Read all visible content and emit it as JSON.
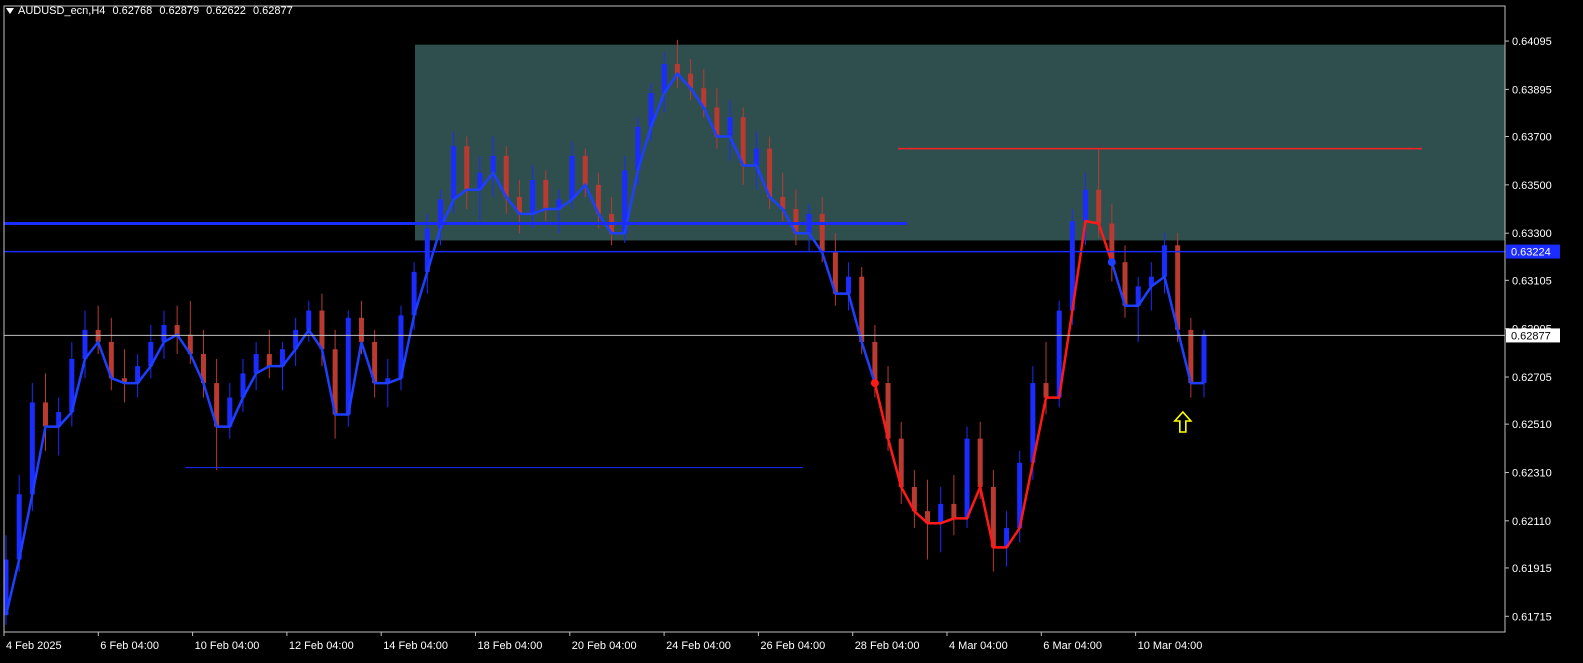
{
  "header": {
    "symbol": "AUDUSD_ecn,H4",
    "open": "0.62768",
    "high": "0.62879",
    "low": "0.62622",
    "close": "0.62877"
  },
  "colors": {
    "background": "#000000",
    "grid_text": "#ffffff",
    "bull_candle": "#1a2cff",
    "bear_candle": "#b83a30",
    "trend_line_up": "#1f3fff",
    "trend_line_down": "#ff1a1a",
    "zone_fill": "#2f4f4f",
    "level_line": "#1a2cff",
    "resistance_line": "#ff2020",
    "arrow": "#ffff00",
    "price_label_bg": "#1a2cff"
  },
  "chart_data": {
    "type": "candlestick",
    "title": "AUDUSD_ecn,H4",
    "y_ticks": [
      "0.64095",
      "0.63895",
      "0.63700",
      "0.63500",
      "0.63300",
      "0.63105",
      "0.62905",
      "0.62705",
      "0.62510",
      "0.62310",
      "0.62110",
      "0.61915",
      "0.61715"
    ],
    "x_ticks": [
      "4 Feb 2025",
      "6 Feb 04:00",
      "10 Feb 04:00",
      "12 Feb 04:00",
      "14 Feb 04:00",
      "18 Feb 04:00",
      "20 Feb 04:00",
      "24 Feb 04:00",
      "26 Feb 04:00",
      "28 Feb 04:00",
      "4 Mar 04:00",
      "6 Mar 04:00",
      "10 Mar 04:00"
    ],
    "ylim": [
      0.6165,
      0.6424
    ],
    "current_price": "0.62877",
    "level_price": "0.63224",
    "zone": {
      "top": 0.6408,
      "bottom": 0.6327
    },
    "resistance": 0.6365,
    "support_line": 0.6233,
    "blue_level": 0.6334,
    "candles": [
      [
        0.6172,
        0.6205,
        0.6168,
        0.6195
      ],
      [
        0.6195,
        0.623,
        0.619,
        0.6222
      ],
      [
        0.6222,
        0.6268,
        0.6215,
        0.626
      ],
      [
        0.626,
        0.6272,
        0.624,
        0.625
      ],
      [
        0.625,
        0.6262,
        0.6238,
        0.6256
      ],
      [
        0.6256,
        0.6285,
        0.625,
        0.6278
      ],
      [
        0.6278,
        0.6298,
        0.627,
        0.629
      ],
      [
        0.629,
        0.63,
        0.628,
        0.6285
      ],
      [
        0.6285,
        0.6295,
        0.6265,
        0.627
      ],
      [
        0.627,
        0.6282,
        0.626,
        0.6268
      ],
      [
        0.6268,
        0.628,
        0.6262,
        0.6275
      ],
      [
        0.6275,
        0.6292,
        0.627,
        0.6285
      ],
      [
        0.6285,
        0.6298,
        0.6278,
        0.6292
      ],
      [
        0.6292,
        0.63,
        0.628,
        0.6288
      ],
      [
        0.6288,
        0.6302,
        0.6276,
        0.628
      ],
      [
        0.628,
        0.629,
        0.6262,
        0.6268
      ],
      [
        0.6268,
        0.6278,
        0.6232,
        0.625
      ],
      [
        0.625,
        0.6268,
        0.6245,
        0.6262
      ],
      [
        0.6262,
        0.6278,
        0.6256,
        0.6272
      ],
      [
        0.6272,
        0.6285,
        0.6265,
        0.628
      ],
      [
        0.628,
        0.629,
        0.627,
        0.6275
      ],
      [
        0.6275,
        0.6285,
        0.6265,
        0.6282
      ],
      [
        0.6282,
        0.6295,
        0.6275,
        0.629
      ],
      [
        0.629,
        0.6302,
        0.6285,
        0.6298
      ],
      [
        0.6298,
        0.6305,
        0.6275,
        0.6282
      ],
      [
        0.6282,
        0.629,
        0.6245,
        0.6255
      ],
      [
        0.6255,
        0.6298,
        0.625,
        0.6295
      ],
      [
        0.6295,
        0.6302,
        0.628,
        0.6285
      ],
      [
        0.6285,
        0.629,
        0.6262,
        0.6268
      ],
      [
        0.6268,
        0.6278,
        0.6258,
        0.627
      ],
      [
        0.627,
        0.63,
        0.6265,
        0.6296
      ],
      [
        0.6296,
        0.6318,
        0.629,
        0.6314
      ],
      [
        0.6314,
        0.6338,
        0.6305,
        0.6332
      ],
      [
        0.6332,
        0.6348,
        0.6325,
        0.6344
      ],
      [
        0.6344,
        0.6372,
        0.6338,
        0.6366
      ],
      [
        0.6366,
        0.637,
        0.634,
        0.6348
      ],
      [
        0.6348,
        0.6362,
        0.6335,
        0.6355
      ],
      [
        0.6355,
        0.637,
        0.6345,
        0.6362
      ],
      [
        0.6362,
        0.6366,
        0.6338,
        0.6345
      ],
      [
        0.6345,
        0.6352,
        0.633,
        0.6338
      ],
      [
        0.6338,
        0.6358,
        0.6332,
        0.6352
      ],
      [
        0.6352,
        0.6356,
        0.6335,
        0.634
      ],
      [
        0.634,
        0.6348,
        0.633,
        0.6344
      ],
      [
        0.6344,
        0.6368,
        0.634,
        0.6362
      ],
      [
        0.6362,
        0.6365,
        0.6345,
        0.635
      ],
      [
        0.635,
        0.6355,
        0.6332,
        0.6338
      ],
      [
        0.6338,
        0.6345,
        0.6325,
        0.633
      ],
      [
        0.633,
        0.6362,
        0.6326,
        0.6356
      ],
      [
        0.6356,
        0.6378,
        0.635,
        0.6374
      ],
      [
        0.6374,
        0.6392,
        0.6368,
        0.6388
      ],
      [
        0.6388,
        0.6405,
        0.638,
        0.64
      ],
      [
        0.64,
        0.641,
        0.639,
        0.6396
      ],
      [
        0.6396,
        0.6402,
        0.6385,
        0.639
      ],
      [
        0.639,
        0.6398,
        0.6378,
        0.6382
      ],
      [
        0.6382,
        0.639,
        0.6365,
        0.637
      ],
      [
        0.637,
        0.6385,
        0.636,
        0.6378
      ],
      [
        0.6378,
        0.6382,
        0.635,
        0.6358
      ],
      [
        0.6358,
        0.6372,
        0.6348,
        0.6365
      ],
      [
        0.6365,
        0.637,
        0.634,
        0.6345
      ],
      [
        0.6345,
        0.6355,
        0.6335,
        0.634
      ],
      [
        0.634,
        0.6348,
        0.6325,
        0.633
      ],
      [
        0.633,
        0.6342,
        0.6322,
        0.6338
      ],
      [
        0.6338,
        0.6345,
        0.6318,
        0.6322
      ],
      [
        0.6322,
        0.633,
        0.63,
        0.6305
      ],
      [
        0.6305,
        0.6318,
        0.6298,
        0.6312
      ],
      [
        0.6312,
        0.6316,
        0.628,
        0.6285
      ],
      [
        0.6285,
        0.6292,
        0.6262,
        0.6268
      ],
      [
        0.6268,
        0.6275,
        0.624,
        0.6245
      ],
      [
        0.6245,
        0.6252,
        0.6218,
        0.6225
      ],
      [
        0.6225,
        0.6232,
        0.6208,
        0.6215
      ],
      [
        0.6215,
        0.6228,
        0.6195,
        0.621
      ],
      [
        0.621,
        0.6225,
        0.6198,
        0.6218
      ],
      [
        0.6218,
        0.623,
        0.6205,
        0.6212
      ],
      [
        0.6212,
        0.625,
        0.6208,
        0.6245
      ],
      [
        0.6245,
        0.6252,
        0.622,
        0.6225
      ],
      [
        0.6225,
        0.6232,
        0.619,
        0.62
      ],
      [
        0.62,
        0.6215,
        0.6192,
        0.6208
      ],
      [
        0.6208,
        0.624,
        0.6202,
        0.6235
      ],
      [
        0.6235,
        0.6275,
        0.6228,
        0.6268
      ],
      [
        0.6268,
        0.6285,
        0.6255,
        0.6262
      ],
      [
        0.6262,
        0.6302,
        0.6258,
        0.6298
      ],
      [
        0.6298,
        0.634,
        0.6292,
        0.6335
      ],
      [
        0.6335,
        0.6355,
        0.6325,
        0.6348
      ],
      [
        0.6348,
        0.6365,
        0.6328,
        0.6334
      ],
      [
        0.6334,
        0.6342,
        0.631,
        0.6318
      ],
      [
        0.6318,
        0.6325,
        0.6295,
        0.63
      ],
      [
        0.63,
        0.6312,
        0.6285,
        0.6308
      ],
      [
        0.6308,
        0.6318,
        0.6298,
        0.6312
      ],
      [
        0.6312,
        0.633,
        0.6305,
        0.6325
      ],
      [
        0.6325,
        0.633,
        0.6285,
        0.629
      ],
      [
        0.629,
        0.6295,
        0.6262,
        0.6268
      ],
      [
        0.6268,
        0.629,
        0.6262,
        0.6288
      ]
    ]
  },
  "annotations": {
    "arrow_icon": "up-arrow-icon"
  }
}
